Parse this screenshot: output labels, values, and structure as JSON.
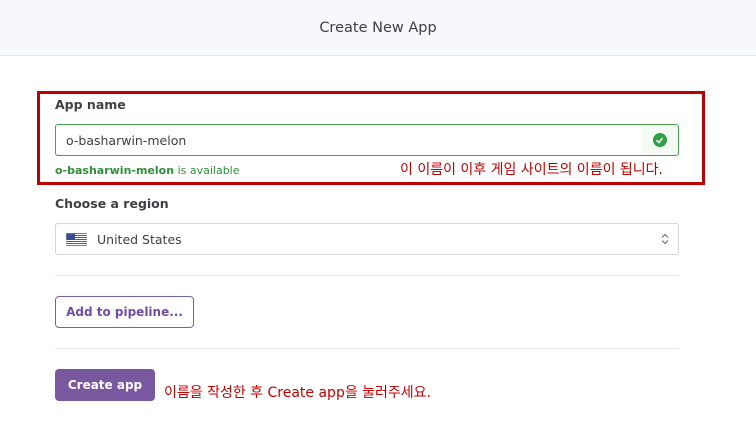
{
  "header": {
    "title": "Create New App"
  },
  "app_name": {
    "label": "App name",
    "value": "o-basharwin-melon",
    "status": "valid",
    "availability": {
      "name": "o-basharwin-melon",
      "suffix": "is available"
    }
  },
  "annotations": {
    "name_note": "이 이름이 이후 게임 사이트의 이름이 됩니다.",
    "create_note": "이름을 작성한 후 Create app을 눌러주세요."
  },
  "region": {
    "label": "Choose a region",
    "selected": "United States",
    "flag_icon": "us-flag-icon"
  },
  "pipeline": {
    "button_label": "Add to pipeline..."
  },
  "actions": {
    "create_label": "Create app"
  },
  "colors": {
    "accent": "#79589f",
    "success": "#47a34b",
    "annotation": "#c00000"
  }
}
